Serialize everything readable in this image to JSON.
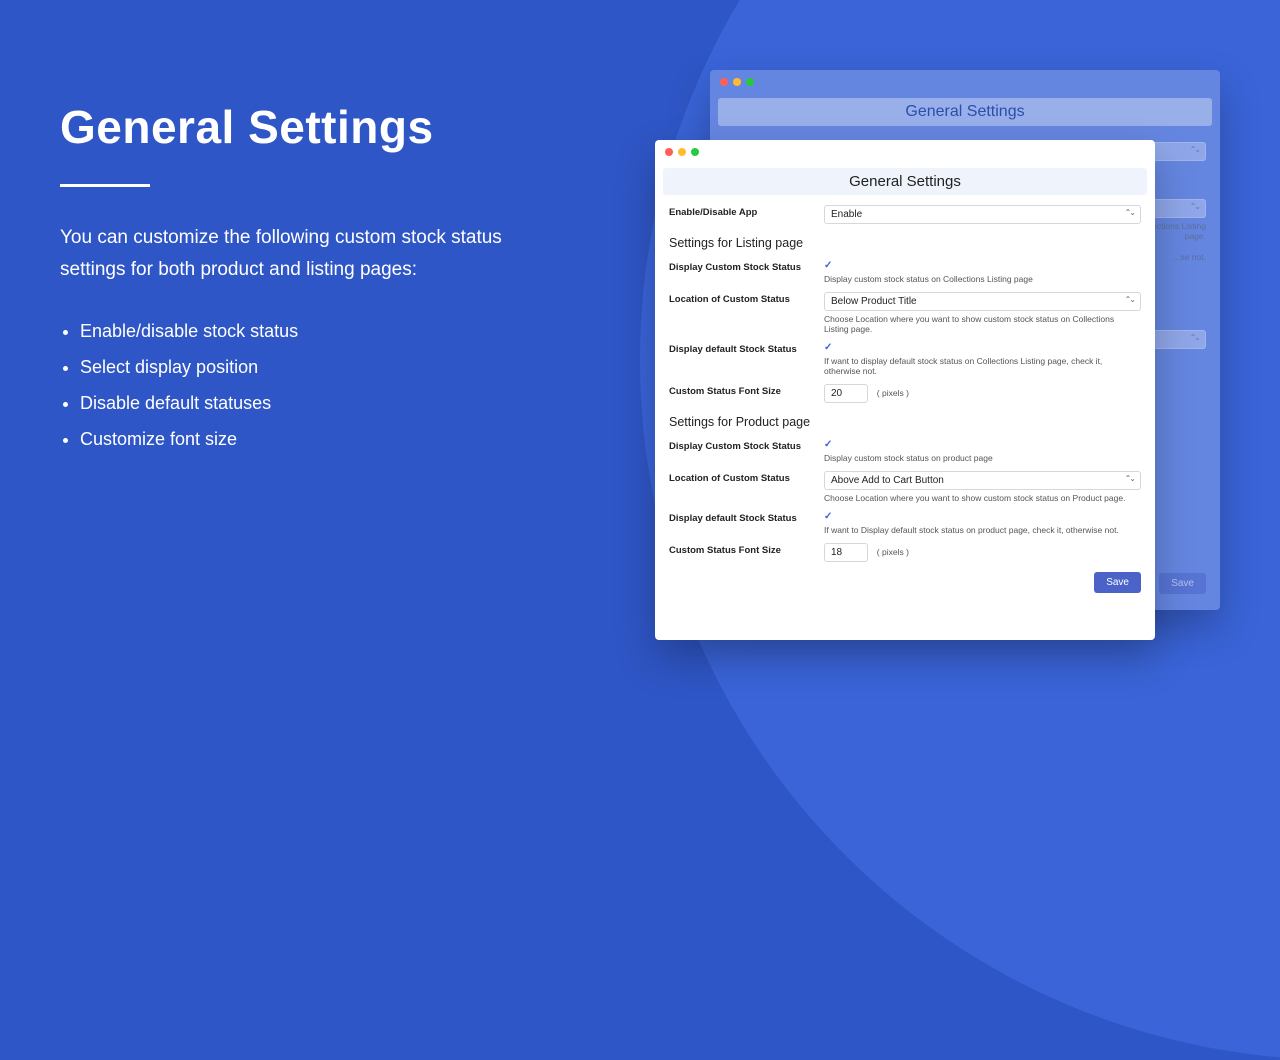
{
  "hero": {
    "title": "General Settings",
    "lead": "You can customize the following custom stock status settings for both product and listing pages:",
    "bullets": [
      "Enable/disable stock status",
      "Select display position",
      "Disable default statuses",
      "Customize font size"
    ]
  },
  "back_window": {
    "title": "General Settings",
    "hint_location": "Choose Location where you want to show custom stock status on Collections Listing page.",
    "hint_default": "…se not.",
    "save": "Save"
  },
  "front_window": {
    "title": "General Settings",
    "enable_label": "Enable/Disable App",
    "enable_value": "Enable",
    "listing": {
      "section": "Settings for Listing page",
      "display_custom_label": "Display Custom Stock Status",
      "display_custom_hint": "Display custom stock status on Collections Listing page",
      "location_label": "Location of Custom Status",
      "location_value": "Below Product Title",
      "location_hint": "Choose Location where you want to show custom stock status on Collections Listing page.",
      "display_default_label": "Display default Stock Status",
      "display_default_hint": "If want to display default stock status on Collections Listing page, check it, otherwise not.",
      "font_label": "Custom Status Font Size",
      "font_value": "20",
      "font_unit": "( pixels )"
    },
    "product": {
      "section": "Settings for Product page",
      "display_custom_label": "Display Custom Stock Status",
      "display_custom_hint": "Display custom stock status on product page",
      "location_label": "Location of Custom Status",
      "location_value": "Above Add to Cart Button",
      "location_hint": "Choose Location where you want to show custom stock status on Product page.",
      "display_default_label": "Display default Stock Status",
      "display_default_hint": "If want to Display default stock status on product page, check it, otherwise not.",
      "font_label": "Custom Status Font Size",
      "font_value": "18",
      "font_unit": "( pixels )"
    },
    "save": "Save"
  }
}
